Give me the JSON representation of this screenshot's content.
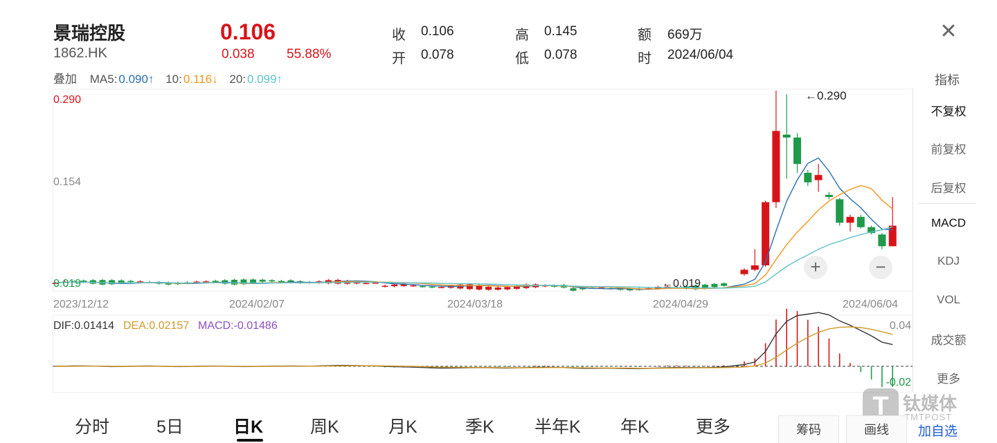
{
  "header": {
    "name": "景瑞控股",
    "code": "1862.HK",
    "price": "0.106",
    "change": "0.038",
    "change_pct": "55.88%",
    "close_label": "收",
    "close_value": "0.106",
    "open_label": "开",
    "open_value": "0.078",
    "high_label": "高",
    "high_value": "0.145",
    "low_label": "低",
    "low_value": "0.078",
    "amount_label": "额",
    "amount_value": "669万",
    "time_label": "时",
    "time_value": "2024/06/04",
    "close_icon": "close-icon"
  },
  "ma_row": {
    "overlay_label": "叠加",
    "ma5_label": "MA5:",
    "ma5_value": "0.090↑",
    "ma10_label": "10:",
    "ma10_value": "0.116↓",
    "ma20_label": "20:",
    "ma20_value": "0.099↑"
  },
  "sidebar": {
    "header": "指标",
    "items": [
      {
        "label": "不复权",
        "active": true
      },
      {
        "label": "前复权",
        "active": false
      },
      {
        "label": "后复权",
        "active": false
      },
      {
        "label": "MACD",
        "active": true
      },
      {
        "label": "KDJ",
        "active": false
      },
      {
        "label": "VOL",
        "active": false
      },
      {
        "label": "成交额",
        "active": false
      },
      {
        "label": "更多",
        "active": false
      }
    ]
  },
  "main_chart": {
    "y_max_label": "0.290",
    "y_mid_label": "0.154",
    "y_min_label": "0.019",
    "high_marker": "←0.290",
    "low_marker": "←0.019",
    "dates": [
      "2023/12/12",
      "2024/02/07",
      "2024/03/18",
      "2024/04/29",
      "2024/06/04"
    ],
    "zoom_in": "+",
    "zoom_out": "−"
  },
  "macd": {
    "dif_label": "DIF:0.01414",
    "dea_label": "DEA:0.02157",
    "macd_label": "MACD:-0.01486",
    "y_top": "0.04",
    "y_bottom": "-0.02"
  },
  "tabs": [
    "分时",
    "5日",
    "日K",
    "周K",
    "月K",
    "季K",
    "半年K",
    "年K",
    "更多"
  ],
  "active_tab": "日K",
  "bottom_buttons": {
    "chips": "筹码",
    "draw": "画线",
    "add": "加自选"
  },
  "watermark": {
    "cn": "钛媒体",
    "en": "TMTPOST"
  },
  "colors": {
    "up": "#d7141a",
    "down": "#1e9a4a",
    "ma5": "#2a6fb0",
    "ma10": "#f0961e",
    "ma20": "#5dc3c8",
    "dif": "#333333",
    "dea": "#d09a2a",
    "macd": "#8a4fc4",
    "link": "#1f5fd6"
  },
  "chart_data": {
    "type": "candlestick",
    "y_range": [
      0.019,
      0.29
    ],
    "x_labels": [
      "2023/12/12",
      "2024/02/07",
      "2024/03/18",
      "2024/04/29",
      "2024/06/04"
    ],
    "last_candle": {
      "date": "2024/06/04",
      "open": 0.078,
      "high": 0.145,
      "low": 0.078,
      "close": 0.106
    },
    "recent_candles": [
      {
        "open": 0.04,
        "high": 0.048,
        "low": 0.038,
        "close": 0.046
      },
      {
        "open": 0.046,
        "high": 0.074,
        "low": 0.044,
        "close": 0.052
      },
      {
        "open": 0.052,
        "high": 0.14,
        "low": 0.05,
        "close": 0.138
      },
      {
        "open": 0.138,
        "high": 0.29,
        "low": 0.13,
        "close": 0.235
      },
      {
        "open": 0.23,
        "high": 0.285,
        "low": 0.17,
        "close": 0.226
      },
      {
        "open": 0.226,
        "high": 0.232,
        "low": 0.178,
        "close": 0.19
      },
      {
        "open": 0.178,
        "high": 0.182,
        "low": 0.16,
        "close": 0.165
      },
      {
        "open": 0.168,
        "high": 0.19,
        "low": 0.152,
        "close": 0.175
      },
      {
        "open": 0.148,
        "high": 0.152,
        "low": 0.142,
        "close": 0.145
      },
      {
        "open": 0.142,
        "high": 0.144,
        "low": 0.106,
        "close": 0.11
      },
      {
        "open": 0.11,
        "high": 0.121,
        "low": 0.098,
        "close": 0.118
      },
      {
        "open": 0.118,
        "high": 0.121,
        "low": 0.102,
        "close": 0.104
      },
      {
        "open": 0.104,
        "high": 0.106,
        "low": 0.094,
        "close": 0.096
      },
      {
        "open": 0.094,
        "high": 0.096,
        "low": 0.074,
        "close": 0.078
      },
      {
        "open": 0.078,
        "high": 0.145,
        "low": 0.078,
        "close": 0.106
      }
    ],
    "ma5_last": 0.09,
    "ma10_last": 0.116,
    "ma20_last": 0.099,
    "macd_range": [
      -0.02,
      0.04
    ],
    "dif_last": 0.01414,
    "dea_last": 0.02157,
    "macd_last": -0.01486
  }
}
